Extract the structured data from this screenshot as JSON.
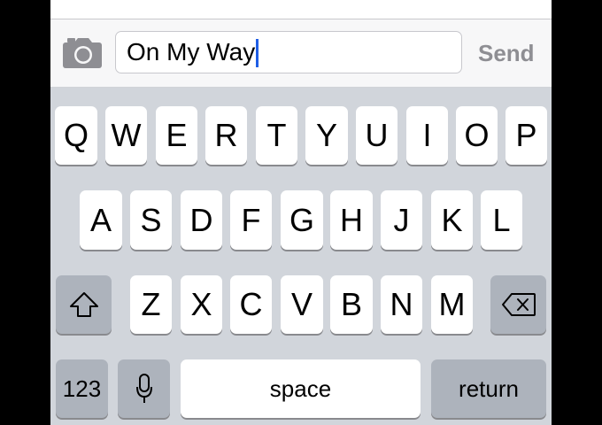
{
  "compose": {
    "message_text": "On My Way",
    "send_label": "Send"
  },
  "keyboard": {
    "row1": [
      "Q",
      "W",
      "E",
      "R",
      "T",
      "Y",
      "U",
      "I",
      "O",
      "P"
    ],
    "row2": [
      "A",
      "S",
      "D",
      "F",
      "G",
      "H",
      "J",
      "K",
      "L"
    ],
    "row3": [
      "Z",
      "X",
      "C",
      "V",
      "B",
      "N",
      "M"
    ],
    "numbers_label": "123",
    "space_label": "space",
    "return_label": "return"
  },
  "icons": {
    "camera": "camera-icon",
    "shift": "shift-icon",
    "delete": "backspace-icon",
    "mic": "microphone-icon"
  },
  "colors": {
    "caret": "#1f5ee6",
    "send_disabled": "#8e8e93",
    "keyboard_bg": "#d1d5db",
    "function_key": "#adb3bc"
  }
}
